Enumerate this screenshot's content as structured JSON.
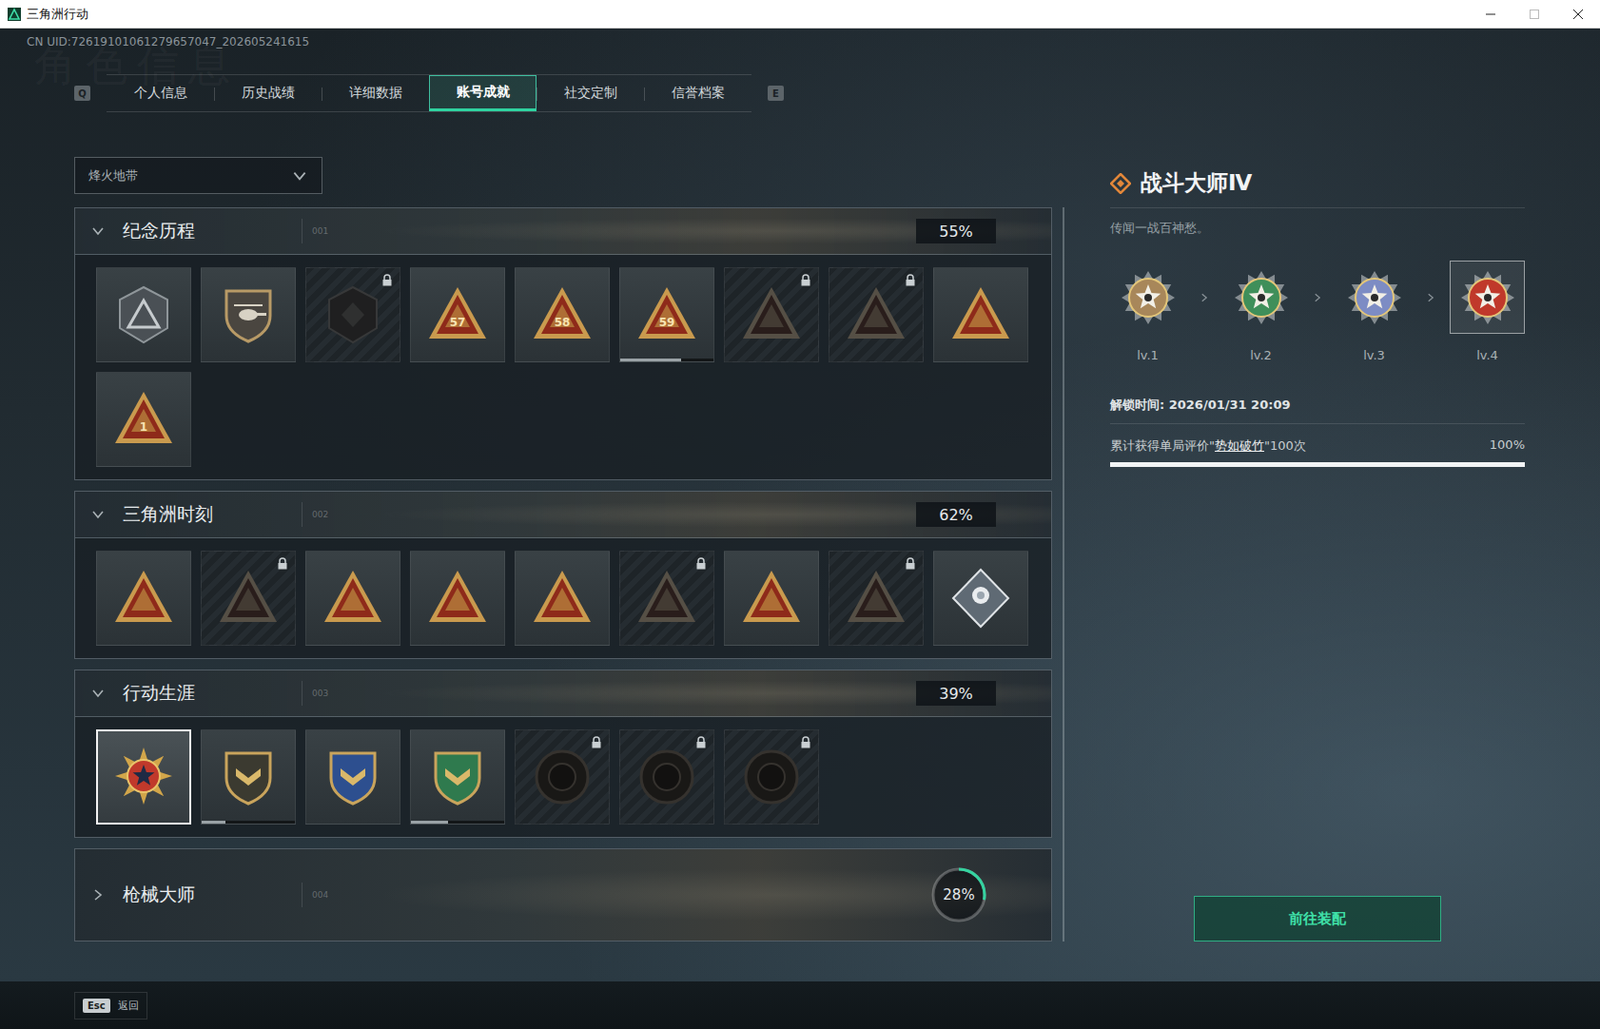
{
  "window": {
    "title": "三角洲行动"
  },
  "uid": "CN UID:72619101061279657047_202605241615",
  "watermark": "角色信息",
  "tabs": {
    "prev_key": "Q",
    "next_key": "E",
    "items": [
      {
        "label": "个人信息",
        "selected": false
      },
      {
        "label": "历史战绩",
        "selected": false
      },
      {
        "label": "详细数据",
        "selected": false
      },
      {
        "label": "账号成就",
        "selected": true
      },
      {
        "label": "社交定制",
        "selected": false
      },
      {
        "label": "信誉档案",
        "selected": false
      }
    ]
  },
  "mode_select": {
    "value": "烽火地带"
  },
  "sections": [
    {
      "title": "纪念历程",
      "code": "001",
      "percent": "55%",
      "expanded": true,
      "badges": [
        {
          "kind": "emblem",
          "locked": false,
          "selected": false
        },
        {
          "kind": "heli",
          "locked": false,
          "selected": false
        },
        {
          "kind": "hex",
          "locked": true,
          "selected": false
        },
        {
          "kind": "triangle",
          "mark": "57",
          "locked": false,
          "selected": false
        },
        {
          "kind": "triangle",
          "mark": "58",
          "locked": false,
          "selected": false
        },
        {
          "kind": "triangle",
          "mark": "59",
          "locked": false,
          "selected": false,
          "level": 0.65
        },
        {
          "kind": "triangle",
          "locked": true,
          "selected": false
        },
        {
          "kind": "triangle",
          "locked": true,
          "selected": false
        },
        {
          "kind": "triangle",
          "locked": false,
          "selected": false
        },
        {
          "kind": "triangle",
          "mark": "1",
          "locked": false,
          "selected": false
        }
      ]
    },
    {
      "title": "三角洲时刻",
      "code": "002",
      "percent": "62%",
      "expanded": true,
      "badges": [
        {
          "kind": "triangle",
          "locked": false,
          "selected": false
        },
        {
          "kind": "triangle",
          "locked": true,
          "selected": false
        },
        {
          "kind": "triangle",
          "locked": false,
          "selected": false
        },
        {
          "kind": "triangle",
          "locked": false,
          "selected": false
        },
        {
          "kind": "triangle",
          "locked": false,
          "selected": false
        },
        {
          "kind": "triangle",
          "locked": true,
          "selected": false
        },
        {
          "kind": "triangle",
          "locked": false,
          "selected": false
        },
        {
          "kind": "triangle",
          "locked": true,
          "selected": false
        },
        {
          "kind": "diamond",
          "locked": false,
          "selected": false
        }
      ]
    },
    {
      "title": "行动生涯",
      "code": "003",
      "percent": "39%",
      "expanded": true,
      "badges": [
        {
          "kind": "star",
          "locked": false,
          "selected": true
        },
        {
          "kind": "shield",
          "color": "#3b3a30",
          "locked": false,
          "selected": false,
          "level": 0.25
        },
        {
          "kind": "shield",
          "color": "#2d4f8f",
          "locked": false,
          "selected": false
        },
        {
          "kind": "shield",
          "color": "#2f7a4e",
          "locked": false,
          "selected": false,
          "level": 0.4
        },
        {
          "kind": "round",
          "locked": true,
          "selected": false
        },
        {
          "kind": "round",
          "locked": true,
          "selected": false
        },
        {
          "kind": "round",
          "locked": true,
          "selected": false
        }
      ]
    },
    {
      "title": "枪械大师",
      "code": "004",
      "percent": "28%",
      "expanded": false,
      "level": 0.28,
      "badges": []
    }
  ],
  "detail": {
    "title": "战斗大师Ⅳ",
    "description": "传闻一战百神愁。",
    "levels": [
      {
        "label": "lv.1",
        "color": "#a8875a",
        "selected": false
      },
      {
        "label": "lv.2",
        "color": "#3f8f5a",
        "selected": false
      },
      {
        "label": "lv.3",
        "color": "#7d8cc4",
        "selected": false
      },
      {
        "label": "lv.4",
        "color": "#c0392b",
        "selected": true
      }
    ],
    "unlock": "解锁时间: 2026/01/31 20:09",
    "requirement": {
      "prefix": "累计获得单局评价\"",
      "highlight": "势如破竹",
      "suffix": "\"100次",
      "percent": "100%",
      "level": 1
    },
    "button": "前往装配"
  },
  "footer": {
    "key": "Esc",
    "label": "返回"
  }
}
